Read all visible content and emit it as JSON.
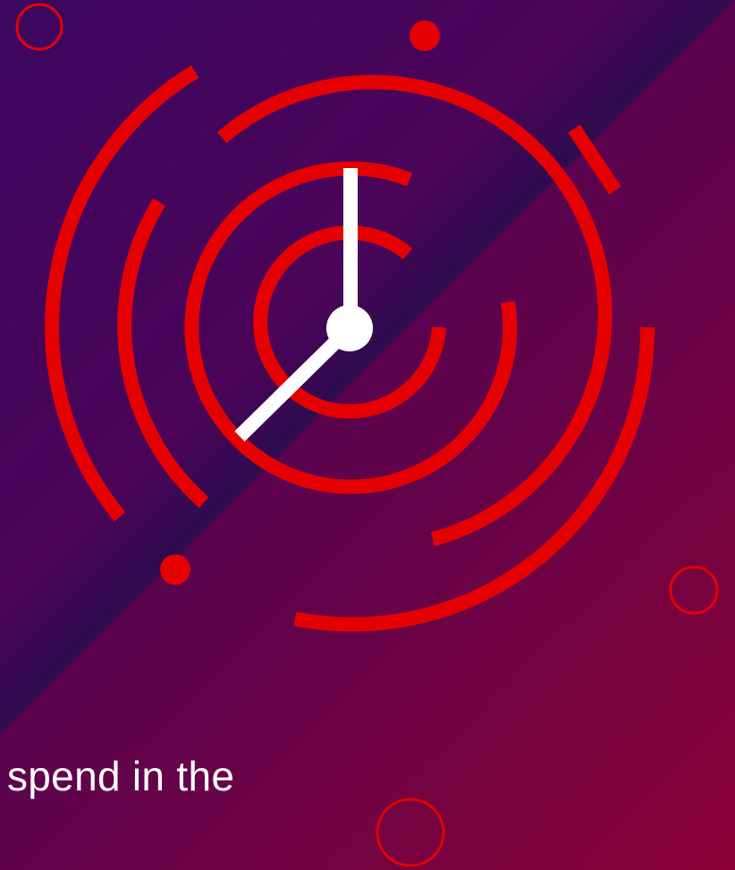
{
  "onboarding": {
    "caption": "spend in the"
  },
  "illustration": {
    "icon": "clock-icon",
    "accent_color": "#e50000",
    "hand_color": "#ffffff"
  },
  "colors": {
    "background_top_left": "#3d0760",
    "background_bottom_right": "#8a0235"
  }
}
